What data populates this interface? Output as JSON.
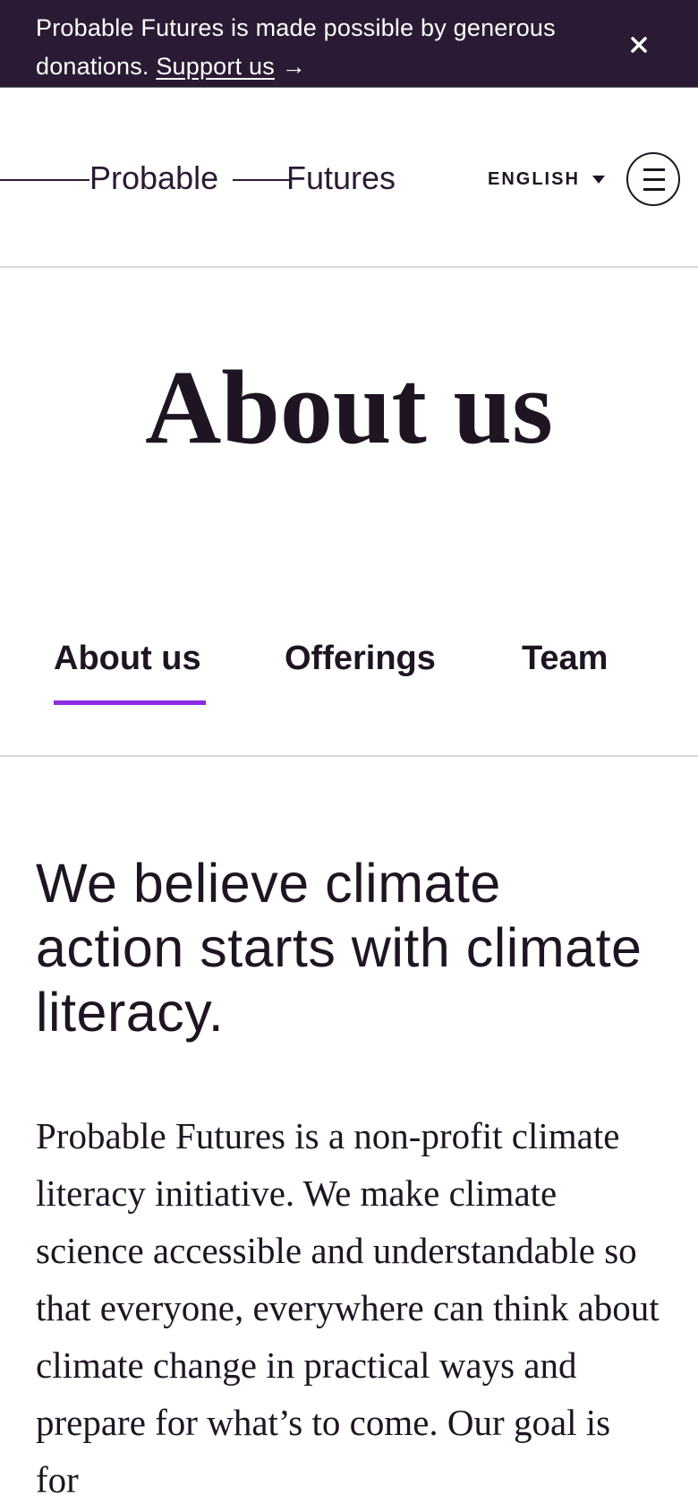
{
  "banner": {
    "text": "Probable Futures is made possible by generous donations.",
    "link_label": "Support us",
    "arrow": "→",
    "close_icon": "close-icon"
  },
  "header": {
    "logo_word_1": "Probable",
    "logo_word_2": "Futures",
    "language_label": "ENGLISH",
    "language_caret_icon": "caret-down-icon",
    "menu_icon": "hamburger-menu-icon"
  },
  "hero": {
    "title": "About us"
  },
  "tabs": [
    {
      "label": "About us",
      "active": true
    },
    {
      "label": "Offerings",
      "active": false
    },
    {
      "label": "Team",
      "active": false
    }
  ],
  "content": {
    "headline": "We believe climate action starts with climate literacy.",
    "body": "Probable Futures is a non-profit climate literacy initiative. We make climate science accessible and understandable so that everyone, everywhere can think about climate change in practical ways and prepare for what’s to come. Our goal is for"
  },
  "colors": {
    "banner_bg": "#2b1a33",
    "text": "#1f1522",
    "active_tab_accent": "#8a2be2",
    "divider": "#d9d9d9"
  }
}
